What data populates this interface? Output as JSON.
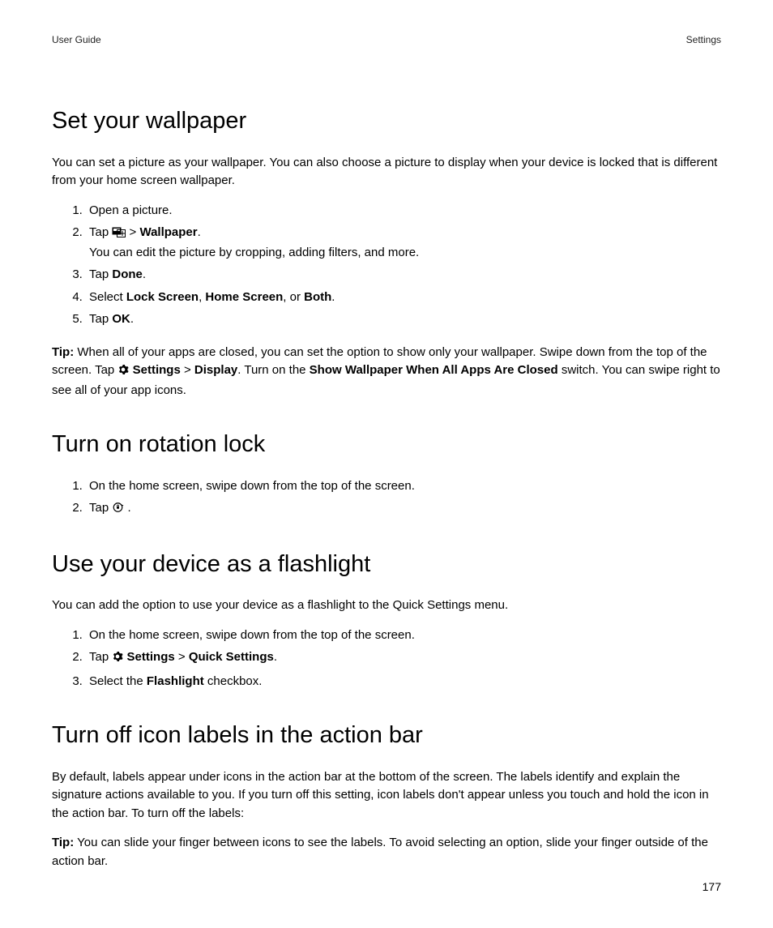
{
  "header": {
    "left": "User Guide",
    "right": "Settings"
  },
  "pageNumber": "177",
  "section1": {
    "heading": "Set your wallpaper",
    "intro": "You can set a picture as your wallpaper. You can also choose a picture to display when your device is locked that is different from your home screen wallpaper.",
    "step1": "Open a picture.",
    "step2_tap": "Tap",
    "step2_sep": " > ",
    "step2_target": "Wallpaper",
    "step2_period": ".",
    "step2_detail": "You can edit the picture by cropping, adding filters, and more.",
    "step3_tap": "Tap ",
    "step3_target": "Done",
    "step3_period": ".",
    "step4_select": "Select ",
    "step4_a": "Lock Screen",
    "step4_b": "Home Screen",
    "step4_c": "Both",
    "step4_comma": ", ",
    "step4_or": ", or ",
    "step4_period": ".",
    "step5_tap": "Tap ",
    "step5_target": "OK",
    "step5_period": ".",
    "tip_label": "Tip:",
    "tip_a": " When all of your apps are closed, you can set the option to show only your wallpaper. Swipe down from the top of the screen. Tap ",
    "tip_settings": "Settings",
    "tip_sep": " > ",
    "tip_display": "Display",
    "tip_b": ". Turn on the ",
    "tip_switch": "Show Wallpaper When All Apps Are Closed",
    "tip_c": " switch. You can swipe right to see all of your app icons."
  },
  "section2": {
    "heading": "Turn on rotation lock",
    "step1": "On the home screen, swipe down from the top of the screen.",
    "step2_tap": "Tap",
    "step2_period": "."
  },
  "section3": {
    "heading": "Use your device as a flashlight",
    "intro": "You can add the option to use your device as a flashlight to the Quick Settings menu.",
    "step1": "On the home screen, swipe down from the top of the screen.",
    "step2_tap": "Tap",
    "step2_settings": "Settings",
    "step2_sep": " > ",
    "step2_quick": "Quick Settings",
    "step2_period": ".",
    "step3_a": "Select the ",
    "step3_b": "Flashlight",
    "step3_c": " checkbox."
  },
  "section4": {
    "heading": "Turn off icon labels in the action bar",
    "intro": "By default, labels appear under icons in the action bar at the bottom of the screen. The labels identify and explain the signature actions available to you. If you turn off this setting, icon labels don't appear unless you touch and hold the icon in the action bar. To turn off the labels:",
    "tip_label": "Tip:",
    "tip_text": " You can slide your finger between icons to see the labels. To avoid selecting an option, slide your finger outside of the action bar."
  }
}
